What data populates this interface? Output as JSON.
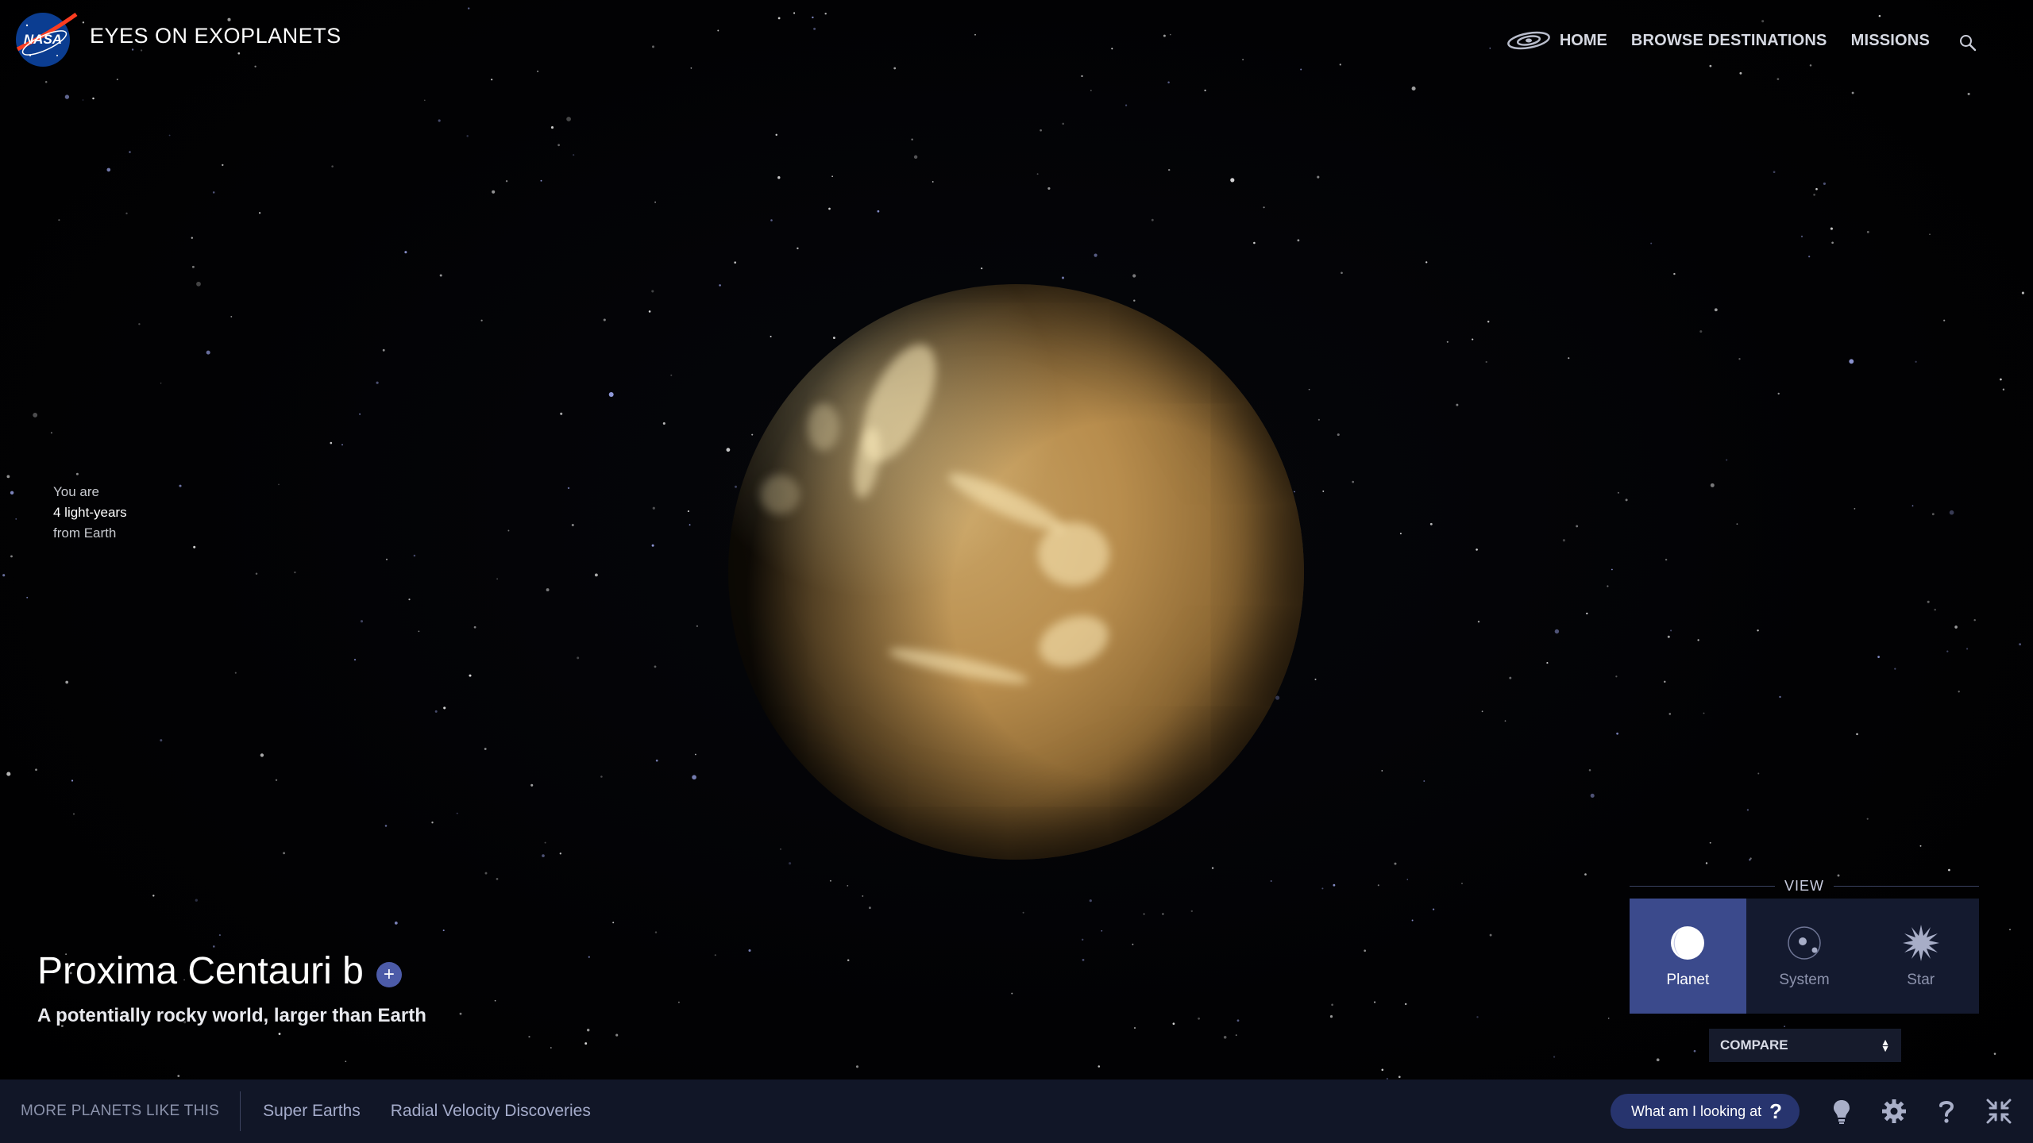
{
  "header": {
    "logo_text": "NASA",
    "title": "EYES ON EXOPLANETS",
    "nav": {
      "home": "HOME",
      "browse": "BROWSE DESTINATIONS",
      "missions": "MISSIONS"
    }
  },
  "distance": {
    "prefix": "You are",
    "value": "4 light-years",
    "suffix": "from Earth"
  },
  "planet": {
    "name": "Proxima Centauri b",
    "add_label": "+",
    "subtitle": "A potentially rocky world, larger than Earth"
  },
  "view": {
    "label": "VIEW",
    "options": [
      {
        "label": "Planet",
        "icon": "planet-icon",
        "active": true
      },
      {
        "label": "System",
        "icon": "system-icon",
        "active": false
      },
      {
        "label": "Star",
        "icon": "star-icon",
        "active": false
      }
    ],
    "compare": "COMPARE"
  },
  "bottom": {
    "more_label": "MORE PLANETS LIKE THIS",
    "links": [
      "Super Earths",
      "Radial Velocity Discoveries"
    ],
    "help_label": "What am I looking at",
    "help_mark": "?",
    "tools": [
      "lightbulb-icon",
      "gear-icon",
      "help-icon",
      "collapse-icon"
    ]
  },
  "colors": {
    "accent": "#3b4a8c",
    "bar": "#111627",
    "pill": "#27346e"
  }
}
